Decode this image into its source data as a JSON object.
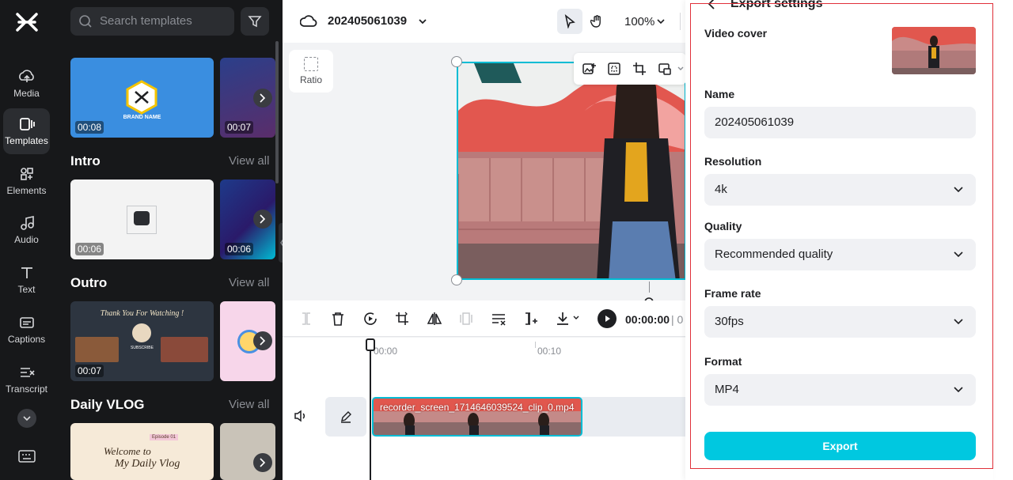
{
  "sidebar": {
    "items": [
      {
        "label": "Media",
        "icon": "media-icon"
      },
      {
        "label": "Templates",
        "icon": "templates-icon"
      },
      {
        "label": "Elements",
        "icon": "elements-icon"
      },
      {
        "label": "Audio",
        "icon": "audio-icon"
      },
      {
        "label": "Text",
        "icon": "text-icon"
      },
      {
        "label": "Captions",
        "icon": "captions-icon"
      },
      {
        "label": "Transcript",
        "icon": "transcript-icon"
      }
    ]
  },
  "templates": {
    "search_placeholder": "Search templates",
    "sections": [
      {
        "title": "Intro",
        "view_all": "View all",
        "durations": [
          "00:06",
          "00:06"
        ]
      },
      {
        "title": "Outro",
        "view_all": "View all",
        "durations": [
          "00:07"
        ]
      },
      {
        "title": "Daily VLOG",
        "view_all": "View all",
        "durations": []
      }
    ],
    "top_durations": [
      "00:08",
      "00:07"
    ],
    "brand_name_text": "BRAND NAME",
    "outro_thumb_text": "Thank You For Watching !",
    "outro_subscribe_text": "SUBSCRIBE",
    "vlog_thumb_text_1": "Welcome to",
    "vlog_thumb_text_2": "My Daily Vlog",
    "vlog_thumb_badge": "Episode 01"
  },
  "topbar": {
    "project_name": "202405061039",
    "zoom": "100%"
  },
  "canvas": {
    "ratio_label": "Ratio"
  },
  "timeline": {
    "time_current": "00:00:00",
    "time_sep": "| 0",
    "ticks": [
      "00:00",
      "00:10"
    ],
    "clip_label": "recorder_screen_1714646039524_clip_0.mp4"
  },
  "export_panel": {
    "title": "Export settings",
    "video_cover_label": "Video cover",
    "name_label": "Name",
    "name_value": "202405061039",
    "resolution_label": "Resolution",
    "resolution_value": "4k",
    "quality_label": "Quality",
    "quality_value": "Recommended quality",
    "frame_rate_label": "Frame rate",
    "frame_rate_value": "30fps",
    "format_label": "Format",
    "format_value": "MP4",
    "export_button": "Export"
  },
  "colors": {
    "accent": "#00c8e0",
    "selection": "#00bcd4",
    "highlight_outline": "#e0303a",
    "dark_bg": "#17181a"
  }
}
